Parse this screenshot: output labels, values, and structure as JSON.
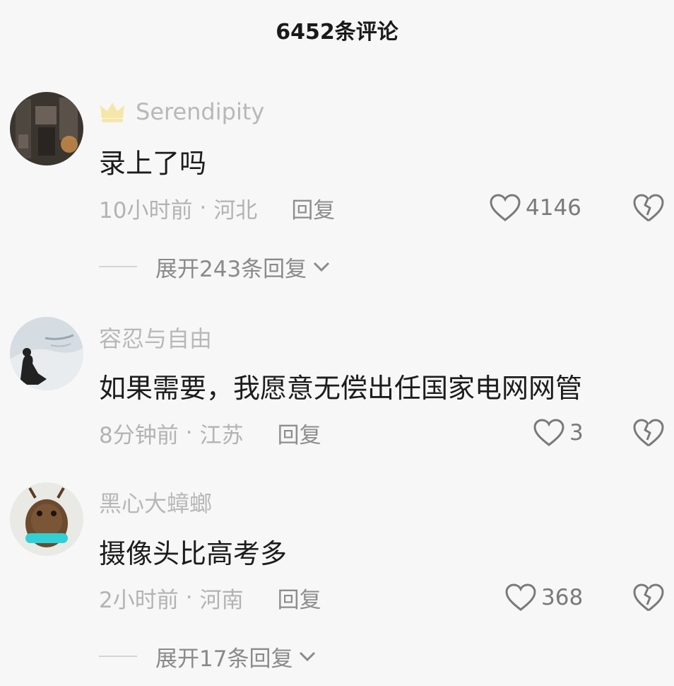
{
  "header": {
    "title": "6452条评论"
  },
  "comments": [
    {
      "username": "Serendipity",
      "text": "录上了吗",
      "time": "10小时前",
      "location": "河北",
      "reply_label": "回复",
      "likes": "4146",
      "expand_label": "展开243条回复"
    },
    {
      "username": "容忍与自由",
      "text": "如果需要，我愿意无偿出任国家电网网管",
      "time": "8分钟前",
      "location": "江苏",
      "reply_label": "回复",
      "likes": "3"
    },
    {
      "username": "黑心大蟑螂",
      "text": "摄像头比高考多",
      "time": "2小时前",
      "location": "河南",
      "reply_label": "回复",
      "likes": "368",
      "expand_label": "展开17条回复"
    }
  ],
  "separator": "·",
  "icons": {
    "badge": "crown-icon",
    "like": "heart-outline-icon",
    "dislike": "broken-heart-icon",
    "expand": "chevron-down-icon"
  },
  "colors": {
    "background": "#f7f7f7",
    "badge": "#f6e7a8",
    "username": "#b8b8b8",
    "text": "#1c1c1c",
    "meta": "#b3b3b3"
  }
}
